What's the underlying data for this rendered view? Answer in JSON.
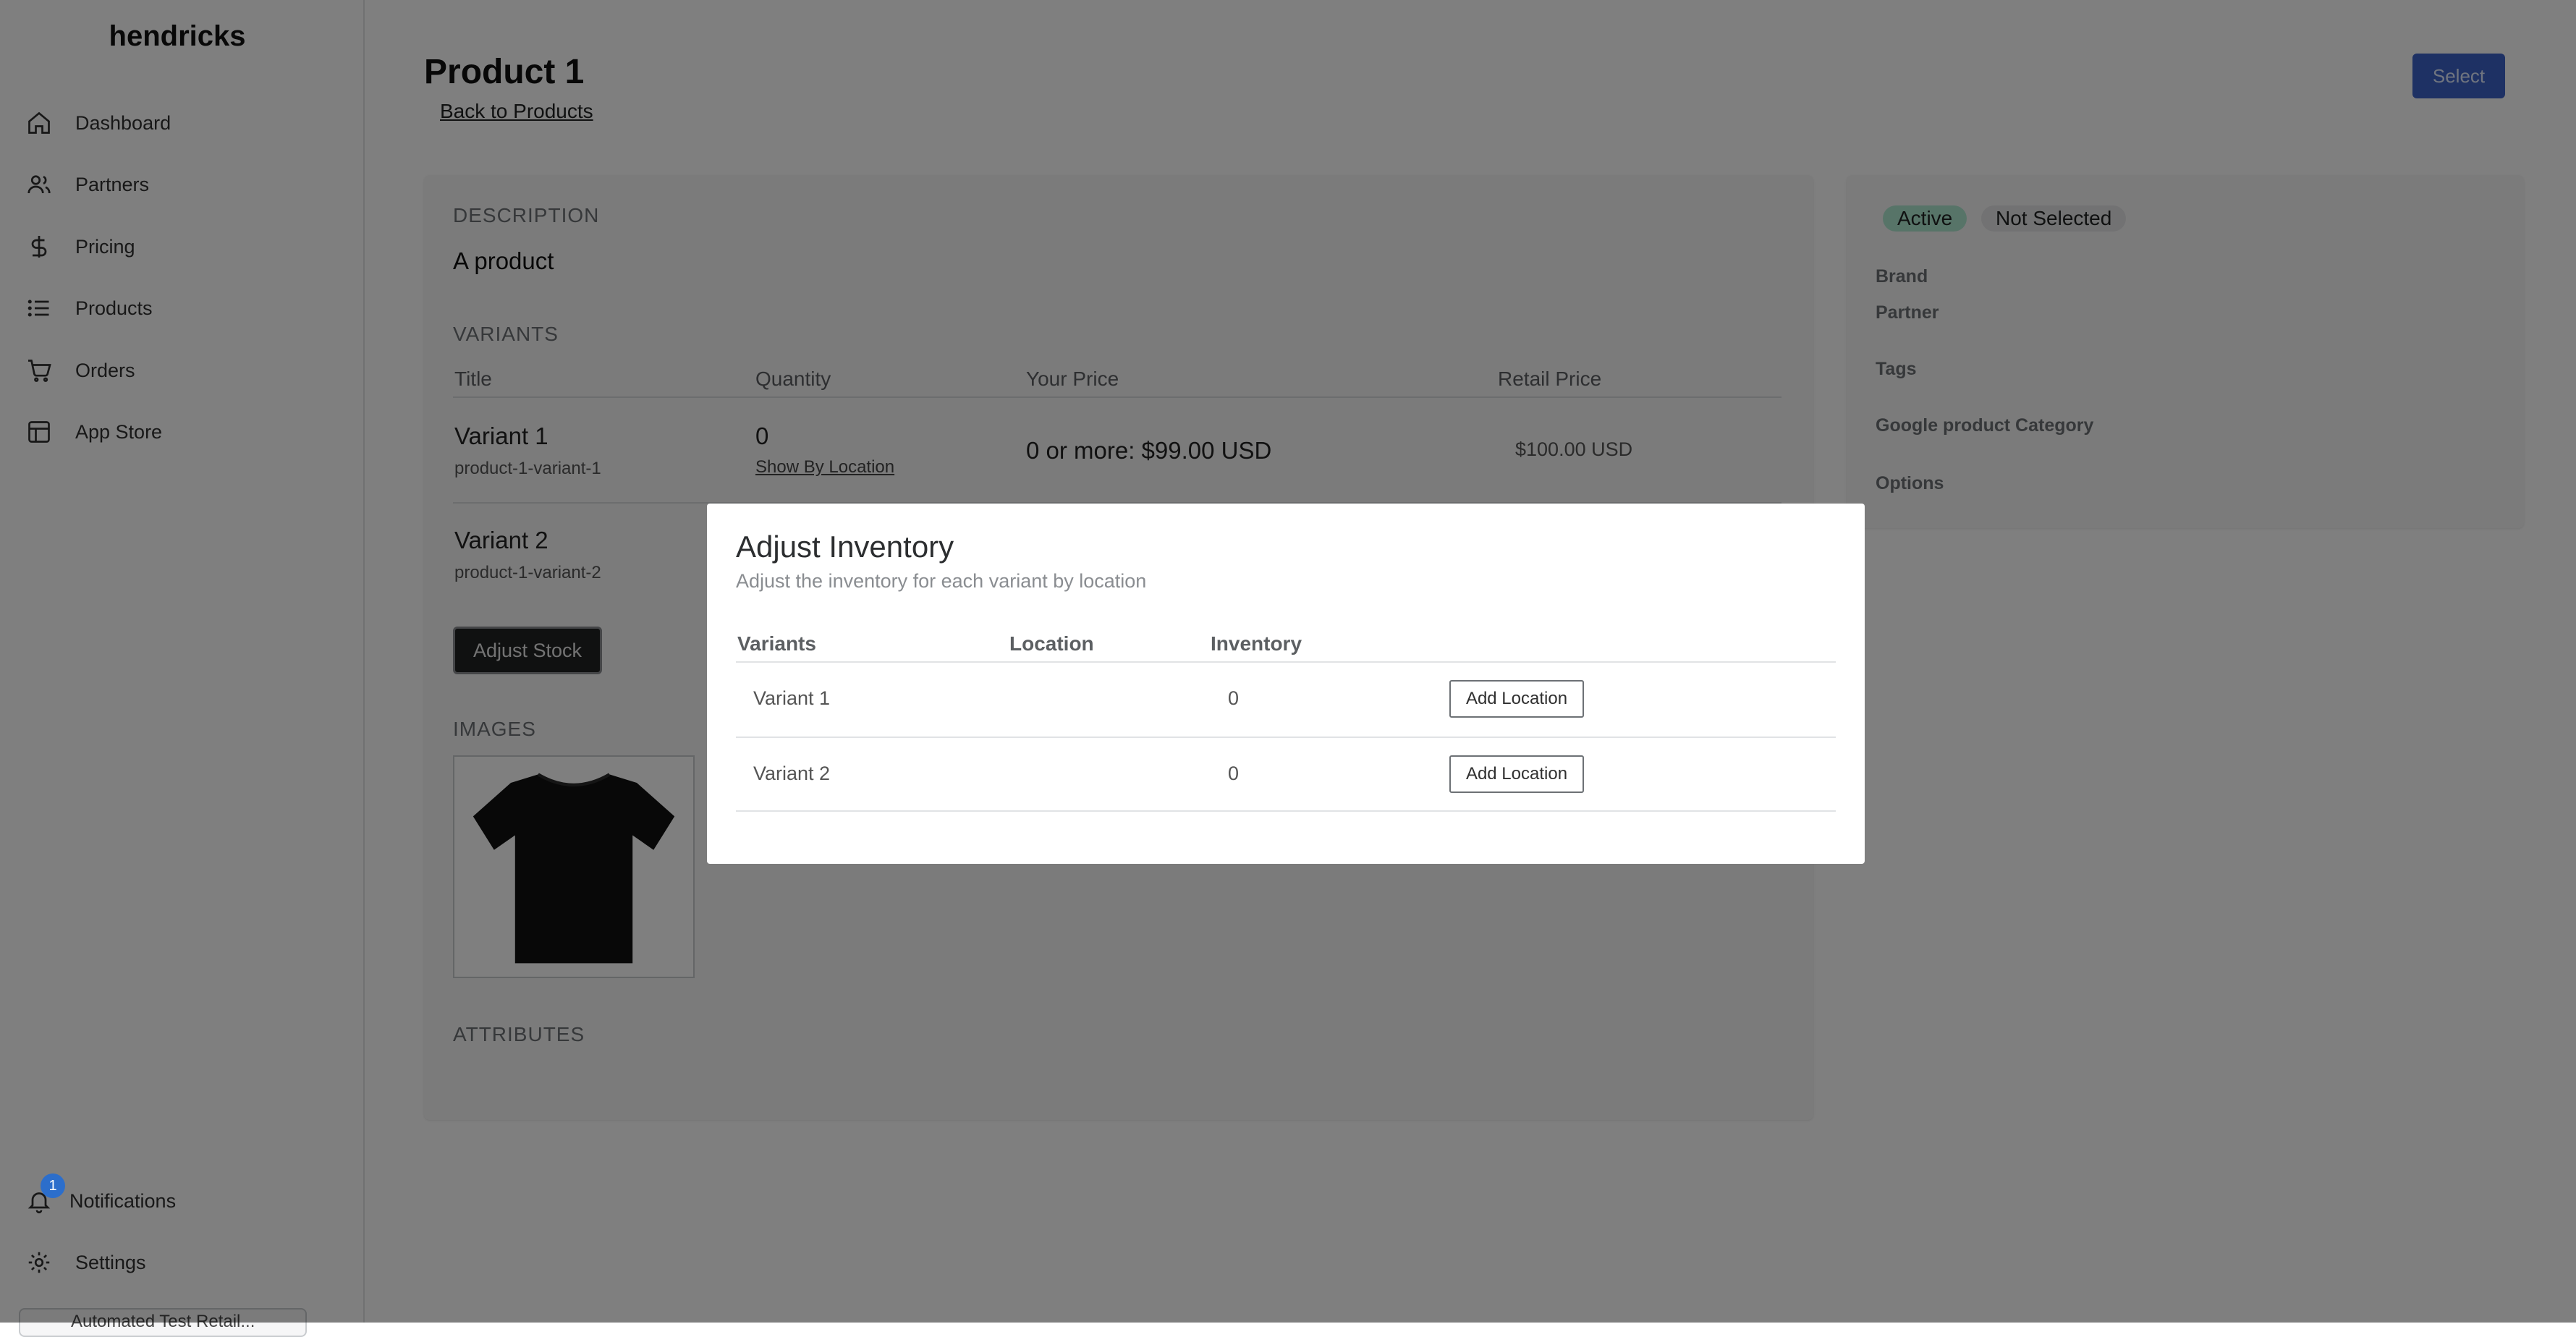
{
  "sidebar": {
    "brand": "hendricks",
    "items": [
      {
        "label": "Dashboard",
        "icon": "home-icon"
      },
      {
        "label": "Partners",
        "icon": "users-icon"
      },
      {
        "label": "Pricing",
        "icon": "dollar-icon"
      },
      {
        "label": "Products",
        "icon": "list-icon"
      },
      {
        "label": "Orders",
        "icon": "cart-icon"
      },
      {
        "label": "App Store",
        "icon": "layout-icon"
      }
    ],
    "notifications": {
      "label": "Notifications",
      "badge": "1"
    },
    "settings": {
      "label": "Settings"
    },
    "bottom_chip": "Automated Test Retail..."
  },
  "header": {
    "title": "Product 1",
    "back_link": "Back to Products",
    "select_button": "Select"
  },
  "product": {
    "description_label": "DESCRIPTION",
    "description": "A product",
    "variants_label": "VARIANTS",
    "columns": [
      "Title",
      "Quantity",
      "Your Price",
      "Retail Price"
    ],
    "variants": [
      {
        "title": "Variant 1",
        "sku": "product-1-variant-1",
        "quantity": "0",
        "show_by_location": "Show By Location",
        "your_price": "0 or more: $99.00 USD",
        "retail_price": "$100.00 USD"
      },
      {
        "title": "Variant 2",
        "sku": "product-1-variant-2"
      }
    ],
    "adjust_stock": "Adjust Stock",
    "images_label": "IMAGES",
    "attributes_label": "ATTRIBUTES"
  },
  "side_panel": {
    "badge_active": "Active",
    "badge_not_selected": "Not Selected",
    "brand": "Brand",
    "partner": "Partner",
    "tags": "Tags",
    "google_category": "Google product Category",
    "options": "Options"
  },
  "modal": {
    "title": "Adjust Inventory",
    "subtitle": "Adjust the inventory for each variant by location",
    "columns": [
      "Variants",
      "Location",
      "Inventory"
    ],
    "rows": [
      {
        "variant": "Variant 1",
        "inventory": "0",
        "button": "Add Location"
      },
      {
        "variant": "Variant 2",
        "inventory": "0",
        "button": "Add Location"
      }
    ]
  },
  "colors": {
    "primary": "#3d63c9",
    "badge_active": "#aee9d1",
    "badge_neutral": "#e4e5e7",
    "notification_badge": "#2c6ecb"
  }
}
